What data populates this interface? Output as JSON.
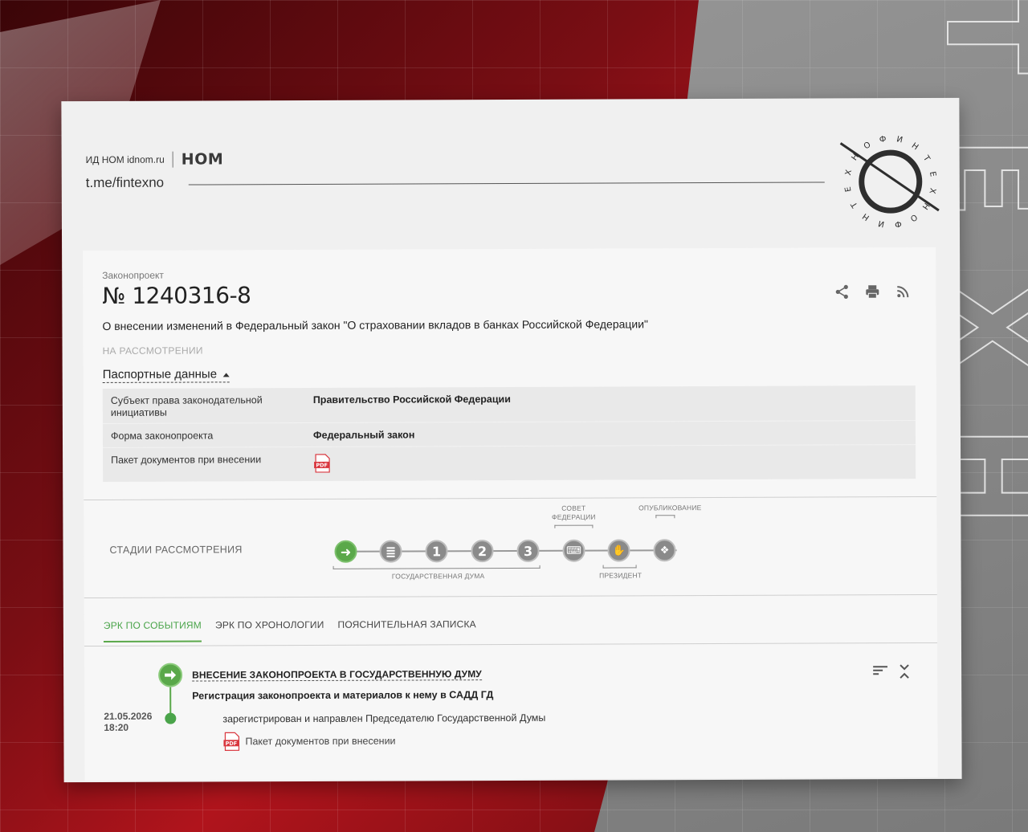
{
  "branding": {
    "publisher": "ИД НОМ idnom.ru",
    "logo": "НОМ",
    "channel": "t.me/fintexno",
    "seal_letters": [
      "Ф",
      "И",
      "Н",
      "Т",
      "Е",
      "Х",
      "Н",
      "О",
      "Ф",
      "И",
      "Н",
      "Т",
      "Е",
      "Х",
      "Н",
      "О"
    ],
    "background_letters": [
      "Т",
      "Е",
      "Х",
      "Н"
    ]
  },
  "bill": {
    "kind": "Законопроект",
    "number": "№ 1240316-8",
    "title": "О внесении изменений в Федеральный закон \"О страховании вкладов в банках Российской Федерации\"",
    "status": "НА РАССМОТРЕНИИ"
  },
  "actions": [
    {
      "icon": "share-icon"
    },
    {
      "icon": "print-icon"
    },
    {
      "icon": "rss-icon"
    }
  ],
  "passport": {
    "toggle_label": "Паспортные данные",
    "rows": [
      {
        "key": "Субъект права законодательной инициативы",
        "value": "Правительство Российской Федерации"
      },
      {
        "key": "Форма законопроекта",
        "value": "Федеральный закон"
      },
      {
        "key": "Пакет документов при внесении",
        "value": "",
        "icon": "pdf-icon"
      }
    ]
  },
  "stages": {
    "label": "СТАДИИ РАССМОТРЕНИЯ",
    "items": [
      {
        "glyph": "➜",
        "icon": "arrow-icon",
        "active": true
      },
      {
        "glyph": "≣",
        "icon": "document-icon",
        "active": false
      },
      {
        "glyph": "1",
        "icon": "reading-1-icon",
        "active": false
      },
      {
        "glyph": "2",
        "icon": "reading-2-icon",
        "active": false
      },
      {
        "glyph": "3",
        "icon": "reading-3-icon",
        "active": false
      },
      {
        "glyph": "⌨",
        "icon": "council-icon",
        "active": false
      },
      {
        "glyph": "✋",
        "icon": "president-icon",
        "active": false
      },
      {
        "glyph": "❖",
        "icon": "emblem-icon",
        "active": false
      }
    ],
    "groups": {
      "duma": "ГОСУДАРСТВЕННАЯ ДУМА",
      "council_line1": "СОВЕТ",
      "council_line2": "ФЕДЕРАЦИИ",
      "president": "ПРЕЗИДЕНТ",
      "published": "ОПУБЛИКОВАНИЕ"
    }
  },
  "tabs": [
    {
      "label": "ЭРК ПО СОБЫТИЯМ",
      "active": true
    },
    {
      "label": "ЭРК ПО ХРОНОЛОГИИ",
      "active": false
    },
    {
      "label": "ПОЯСНИТЕЛЬНАЯ ЗАПИСКА",
      "active": false
    }
  ],
  "event": {
    "title": "ВНЕСЕНИЕ ЗАКОНОПРОЕКТА В ГОСУДАРСТВЕННУЮ ДУМУ",
    "subtitle": "Регистрация законопроекта и материалов к нему в САДД ГД",
    "date": "21.05.2026",
    "time": "18:20",
    "description": "зарегистрирован и направлен Председателю Государственной Думы",
    "document_label": "Пакет документов при внесении",
    "pdf_label": "PDF"
  },
  "colors": {
    "accent_green": "#5aa84a",
    "pdf_red": "#d9363e",
    "bg_red": "#b0141c"
  }
}
